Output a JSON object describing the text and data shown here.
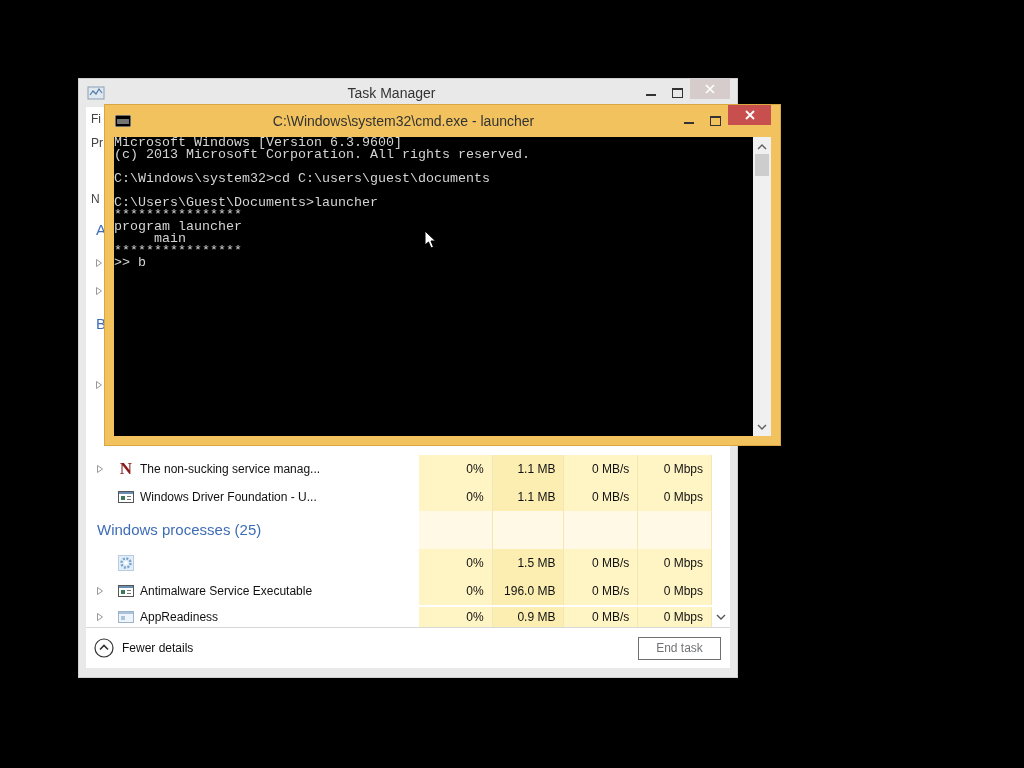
{
  "task_manager": {
    "title": "Task Manager",
    "left_strip": [
      {
        "kind": "menu",
        "text": "Fi"
      },
      {
        "kind": "tab",
        "text": "Pr"
      },
      {
        "kind": "column",
        "text": "N"
      },
      {
        "kind": "heading",
        "text": "A"
      },
      {
        "kind": "expander"
      },
      {
        "kind": "expander"
      },
      {
        "kind": "heading",
        "text": "B"
      },
      {
        "kind": "expander"
      }
    ],
    "rows": [
      {
        "kind": "process",
        "icon_text": "N",
        "name": "The non-sucking service manag...",
        "expandable": true,
        "cpu": "0%",
        "memory": "1.1 MB",
        "disk": "0 MB/s",
        "network": "0 Mbps"
      },
      {
        "kind": "process",
        "name": "Windows Driver Foundation - U...",
        "expandable": false,
        "cpu": "0%",
        "memory": "1.1 MB",
        "disk": "0 MB/s",
        "network": "0 Mbps"
      },
      {
        "kind": "group",
        "name": "Windows processes (25)"
      },
      {
        "kind": "process",
        "expandable": false,
        "cpu": "0%",
        "memory": "1.5 MB",
        "disk": "0 MB/s",
        "network": "0 Mbps"
      },
      {
        "kind": "process",
        "name": "Antimalware Service Executable",
        "expandable": true,
        "cpu": "0%",
        "memory": "196.0 MB",
        "disk": "0 MB/s",
        "network": "0 Mbps"
      },
      {
        "kind": "process",
        "name": "AppReadiness",
        "expandable": true,
        "cpu": "0%",
        "memory": "0.9 MB",
        "disk": "0 MB/s",
        "network": "0 Mbps"
      }
    ],
    "fewer_details": "Fewer details",
    "end_task": {
      "label": "End task",
      "disabled": true
    }
  },
  "cmd": {
    "title": "C:\\Windows\\system32\\cmd.exe - launcher",
    "blocks": [
      [
        "Microsoft Windows [Version 6.3.9600]",
        "(c) 2013 Microsoft Corporation. All rights reserved."
      ],
      [
        "C:\\Windows\\system32>cd C:\\users\\guest\\documents"
      ],
      [
        "C:\\Users\\Guest\\Documents>launcher",
        "****************",
        "program launcher",
        "     main",
        "****************",
        ">> b"
      ]
    ]
  }
}
